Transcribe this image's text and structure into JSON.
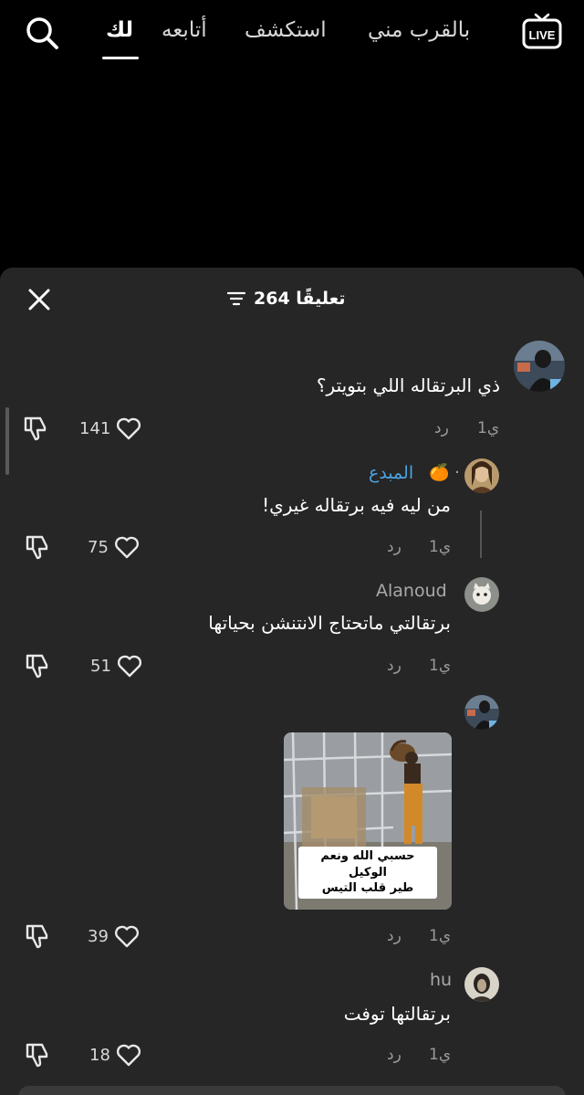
{
  "nav": {
    "tabs": [
      {
        "label": "بالقرب مني"
      },
      {
        "label": "استكشف"
      },
      {
        "label": "أتابعه"
      },
      {
        "label": "لك"
      }
    ],
    "live_label": "LIVE"
  },
  "sheet": {
    "comment_count": "264 تعليقًا"
  },
  "comments": [
    {
      "username": "",
      "text": "ذي البرتقاله اللي بتويتر؟",
      "time": "1ي",
      "reply": "رد",
      "likes": "141"
    },
    {
      "username": "المبدع",
      "badge": "🍊 ·",
      "text": "من ليه فيه برتقاله غيري!",
      "time": "1ي",
      "reply": "رد",
      "likes": "75"
    },
    {
      "username": "Alanoud",
      "text": "برتقالتي ماتحتاج الانتنشن بحياتها",
      "time": "1ي",
      "reply": "رد",
      "likes": "51"
    },
    {
      "username": "",
      "caption_line1": "حسبي الله ونعم الوكيل",
      "caption_line2": "طير قلب التيس",
      "time": "1ي",
      "reply": "رد",
      "likes": "39"
    },
    {
      "username": "hu",
      "text": "برتقالتها توفت",
      "time": "1ي",
      "reply": "رد",
      "likes": "18"
    }
  ],
  "colors": {
    "sheet_bg": "#262626",
    "page_bg": "#000000",
    "link_blue": "#4aa3df"
  }
}
